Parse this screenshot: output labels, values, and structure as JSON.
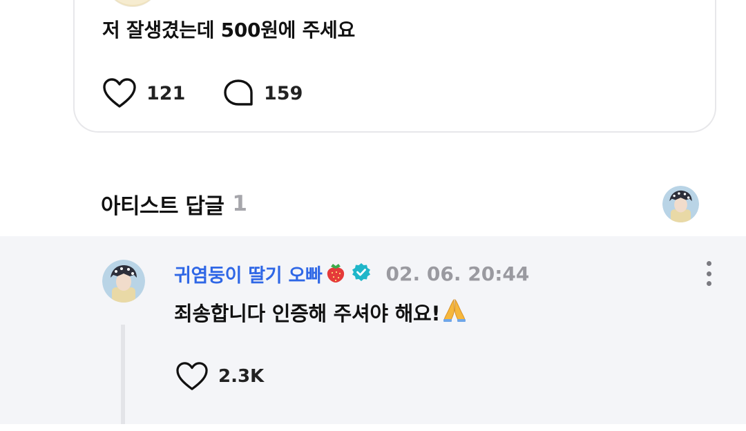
{
  "post": {
    "text": "저 잘생겼는데 500원에 주세요",
    "like_count": "121",
    "comment_count": "159"
  },
  "artist_replies": {
    "title": "아티스트 답글",
    "count": "1"
  },
  "reply": {
    "author": "귀염둥이 딸기 오빠",
    "author_emoji": "🍓",
    "timestamp": "02. 06. 20:44",
    "text": "죄송합니다 인증해 주셔야 해요!",
    "text_emoji": "🙏",
    "like_count": "2.3K"
  },
  "colors": {
    "author_blue": "#2f67e6",
    "verified_teal": "#1fb6c9",
    "reply_bg": "#f4f5f8",
    "muted_gray": "#9a9aa0"
  },
  "icons": {
    "like": "heart-outline-icon",
    "comment": "speech-bubble-icon",
    "verified": "verified-badge-icon",
    "menu": "more-vertical-icon"
  }
}
